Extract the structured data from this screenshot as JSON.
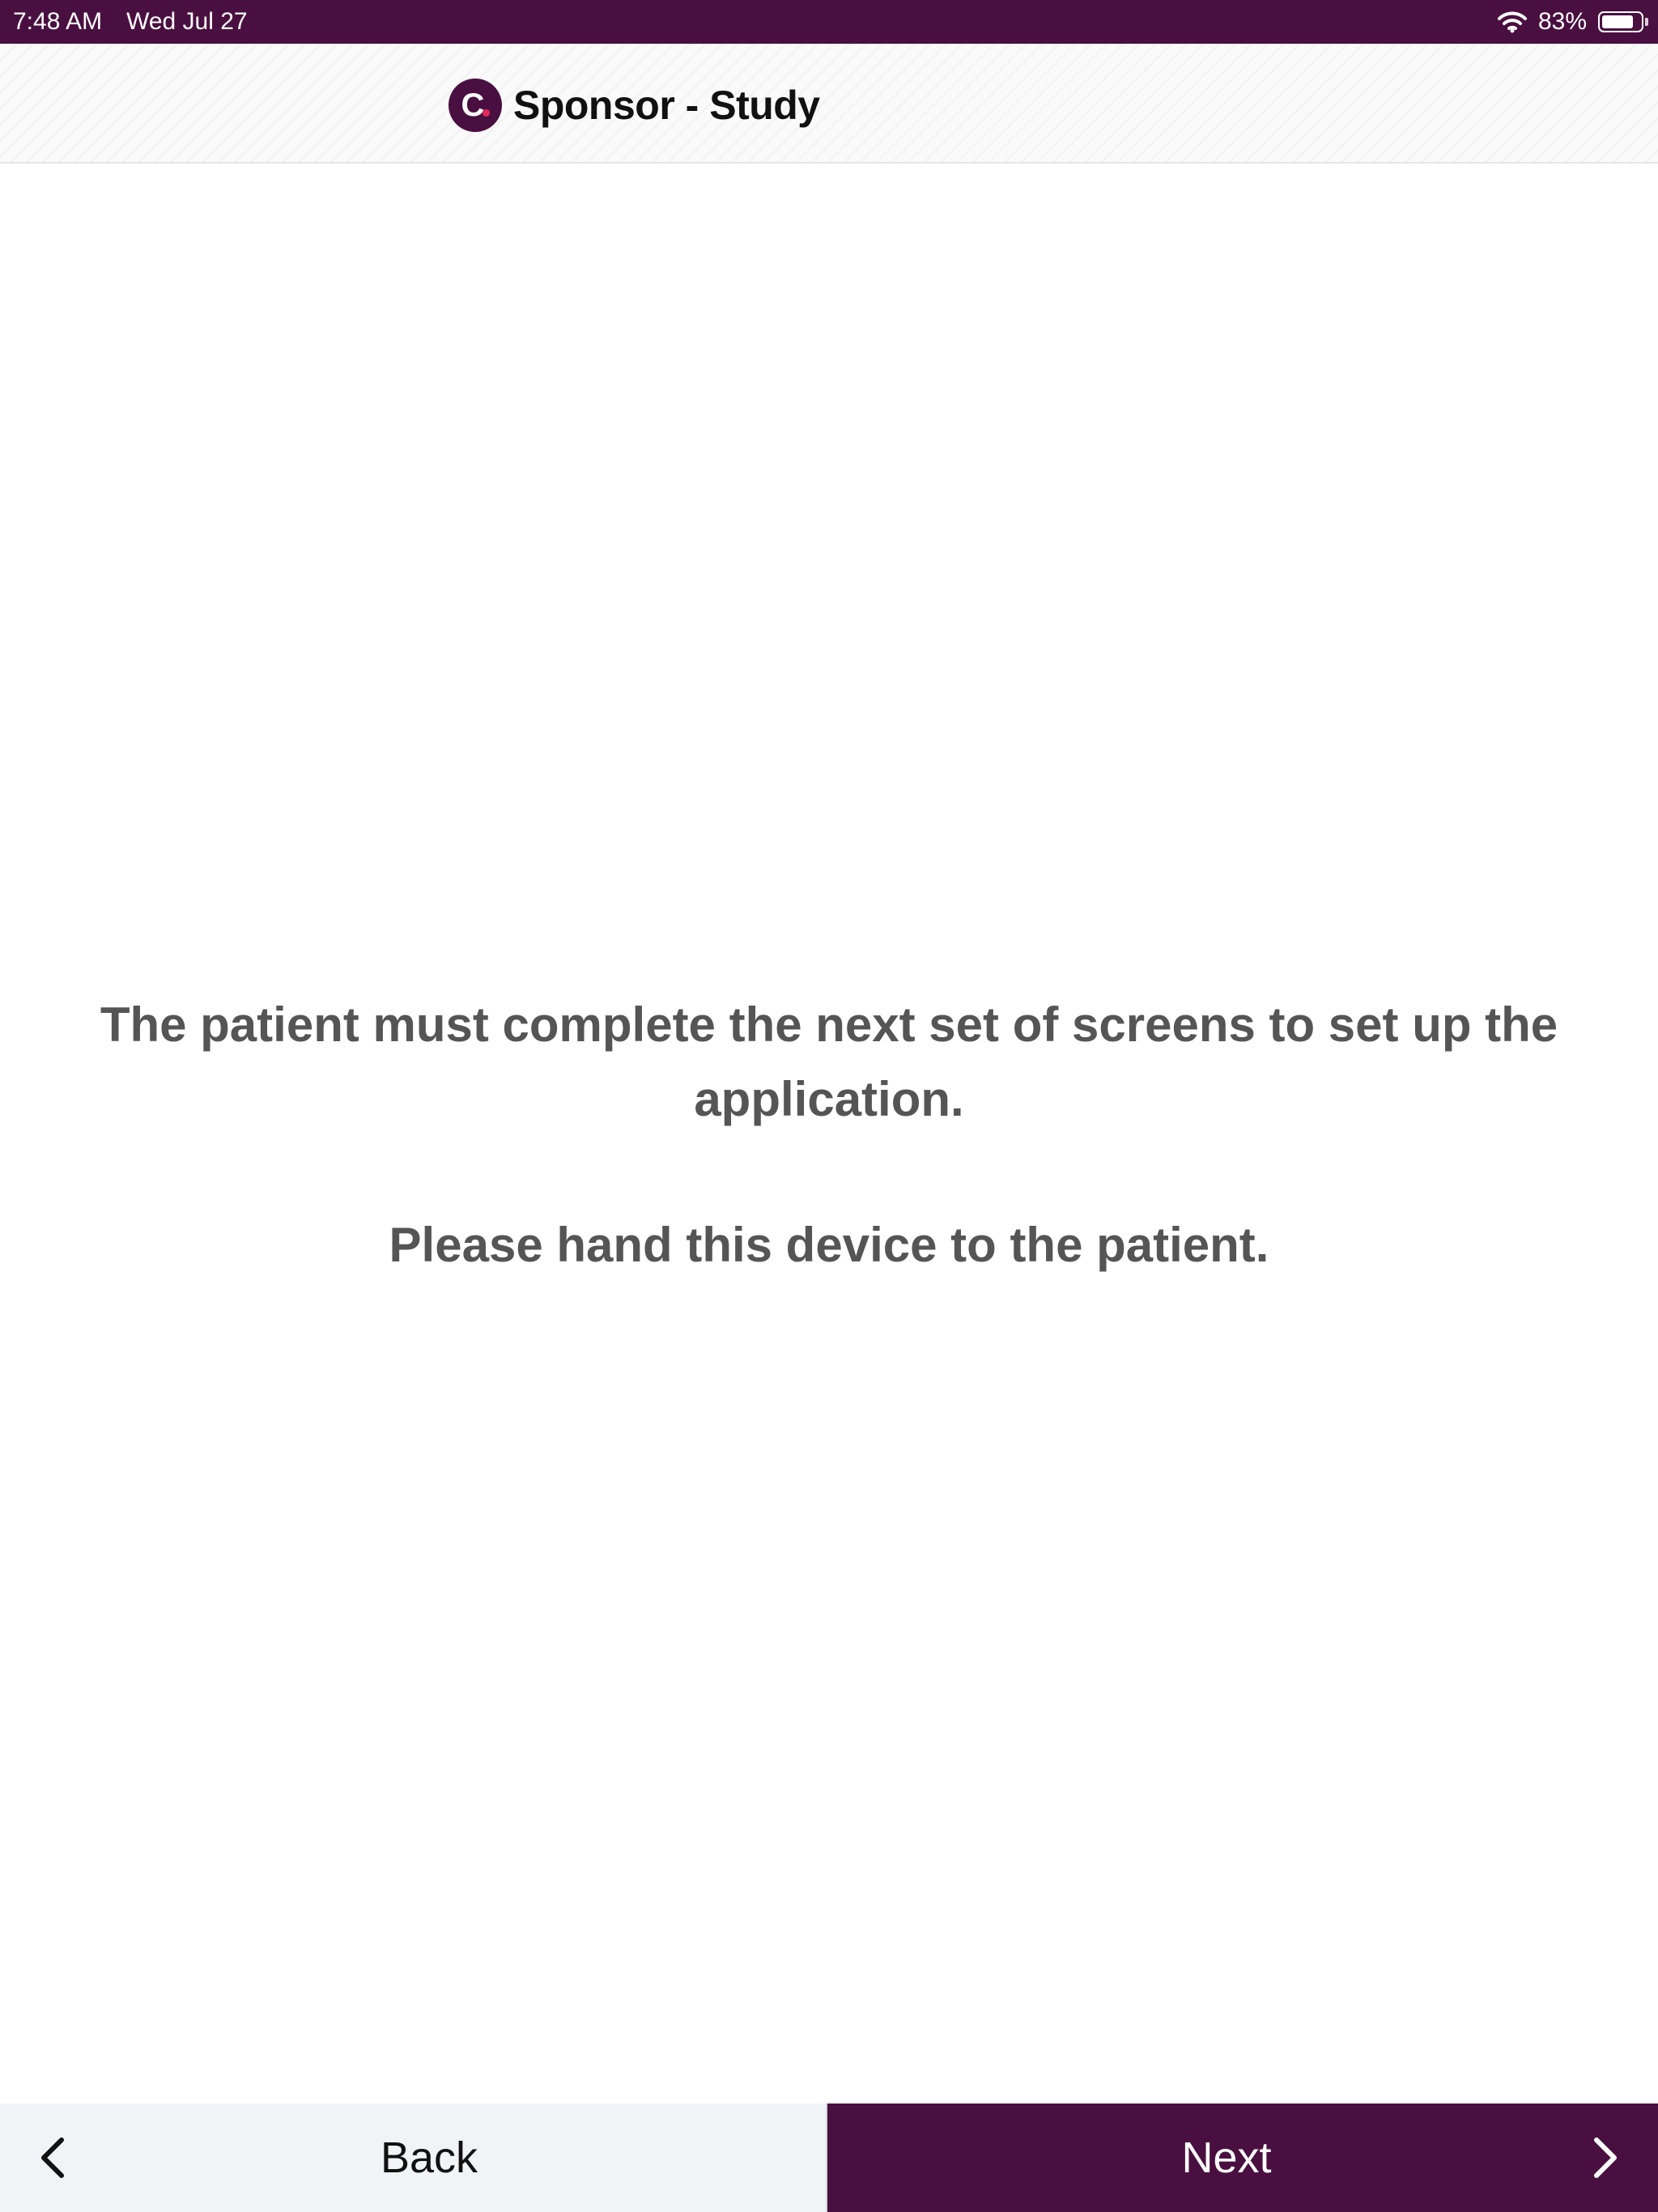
{
  "status_bar": {
    "time": "7:48 AM",
    "date": "Wed Jul 27",
    "battery_percent": "83%",
    "battery_level": 0.83,
    "background_color": "#4a0f41"
  },
  "header": {
    "logo_letter": "C",
    "title": "Sponsor - Study",
    "logo_color": "#4a0f41",
    "logo_dot_color": "#e02a5a"
  },
  "message": {
    "primary": "The patient must complete the next set of screens to set up the application.",
    "secondary": "Please hand this device to the patient.",
    "text_color": "#555555"
  },
  "navigation": {
    "back_label": "Back",
    "next_label": "Next",
    "back_icon": "chevron-left-icon",
    "next_icon": "chevron-right-icon",
    "next_background": "#4a0f41",
    "back_background": "#f0f4f7"
  }
}
